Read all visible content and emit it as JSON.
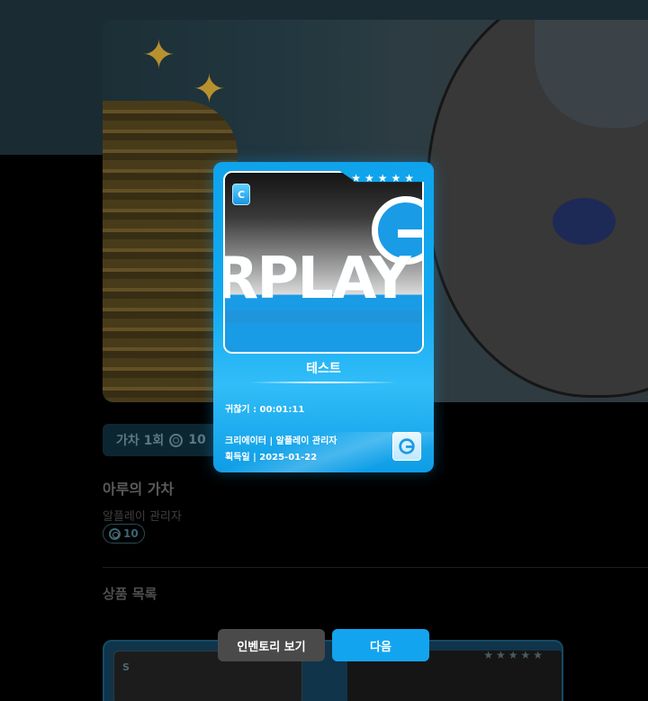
{
  "gacha": {
    "pull_label": "가차 1회",
    "pull_cost": "10",
    "title": "아루의 가차",
    "owner": "알플레이 관리자",
    "cost_badge": "10"
  },
  "section": {
    "items_title": "상품 목록"
  },
  "background_list_card": {
    "grade": "S",
    "stars": "★★★★★"
  },
  "card": {
    "grade": "C",
    "stars": "★★★★★",
    "logo_text": "RPLAY",
    "name": "테스트",
    "expiry_label": "귀찮기 : 00:01:11",
    "creator_label": "크리에이터 | 알플레이 관리자",
    "acquired_label": "획득일 | 2025-01-22",
    "accent_color": "#12a9f0"
  },
  "actions": {
    "inventory_label": "인벤토리 보기",
    "next_label": "다음"
  }
}
